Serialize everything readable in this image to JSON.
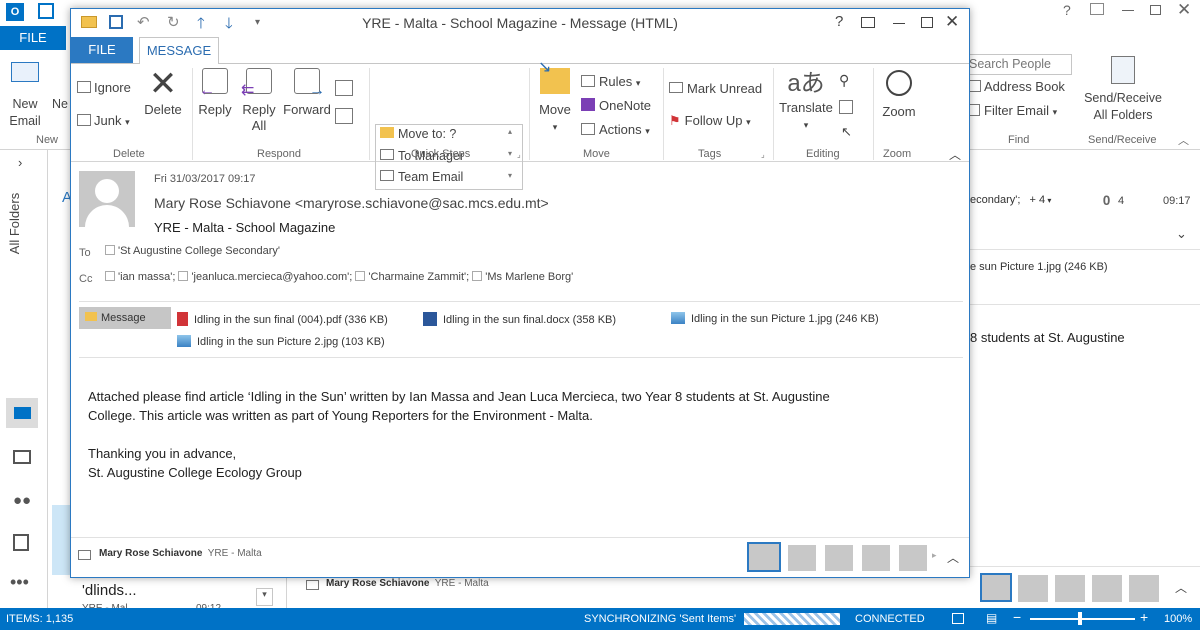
{
  "window": {
    "title": "YRE - Malta - School Magazine - Message (HTML)",
    "help": "?",
    "tab_file": "FILE",
    "tab_message": "MESSAGE"
  },
  "background": {
    "file_tab": "FILE",
    "new_email": "New Email",
    "new_items": "Ne Item",
    "new_group": "New",
    "search_people": "Search People",
    "address_book": "Address Book",
    "filter_email": "Filter Email",
    "find_group": "Find",
    "send_receive": "Send/Receive All Folders",
    "send_receive_group": "Send/Receive",
    "all_folders": "All Folders",
    "right_sender_tail": "econdary';",
    "right_plus": "+ 4",
    "right_attach_count": "4",
    "right_time": "09:17",
    "right_attachment": "e sun Picture 1.jpg (246 KB)",
    "right_body": "8 students at St. Augustine",
    "list_item_text": "'dlinds...",
    "list_item_sub": "YRE - Mal",
    "list_item_time": "09:12",
    "list_letter": "A",
    "bottom_sender": "Mary Rose Schiavone",
    "bottom_subject": "YRE - Malta"
  },
  "ribbon": {
    "delete_group": {
      "label": "Delete",
      "ignore": "Ignore",
      "junk": "Junk",
      "delete": "Delete"
    },
    "respond_group": {
      "label": "Respond",
      "reply": "Reply",
      "reply_all": "Reply All",
      "forward": "Forward"
    },
    "quick_steps": {
      "label": "Quick Steps",
      "items": [
        "Move to: ?",
        "To Manager",
        "Team Email"
      ]
    },
    "move_group": {
      "label": "Move",
      "move": "Move",
      "rules": "Rules",
      "onenote": "OneNote",
      "actions": "Actions"
    },
    "tags_group": {
      "label": "Tags",
      "mark_unread": "Mark Unread",
      "follow_up": "Follow Up"
    },
    "editing_group": {
      "label": "Editing",
      "translate": "Translate"
    },
    "zoom_group": {
      "label": "Zoom",
      "zoom": "Zoom"
    }
  },
  "message": {
    "date": "Fri 31/03/2017 09:17",
    "sender": "Mary Rose Schiavone <maryrose.schiavone@sac.mcs.edu.mt>",
    "subject": "YRE - Malta - School Magazine",
    "to_label": "To",
    "to": [
      "'St Augustine College Secondary'"
    ],
    "cc_label": "Cc",
    "cc": [
      "'ian massa';",
      "'jeanluca.mercieca@yahoo.com';",
      "'Charmaine Zammit';",
      "'Ms Marlene Borg'"
    ],
    "message_tab": "Message",
    "attachments": [
      {
        "name": "Idling in the sun final (004).pdf (336 KB)",
        "icon": "pdf-icon"
      },
      {
        "name": "Idling in the sun final.docx (358 KB)",
        "icon": "word-icon"
      },
      {
        "name": "Idling in the sun Picture 1.jpg (246 KB)",
        "icon": "image-icon"
      },
      {
        "name": "Idling in the sun Picture 2.jpg (103 KB)",
        "icon": "image-icon"
      }
    ],
    "body": [
      "Attached please find article ‘Idling in the Sun’ written by Ian Massa and Jean Luca Mercieca, two Year 8 students at St. Augustine",
      "College.  This article was written as part of Young Reporters for the Environment - Malta.",
      "",
      "Thanking you in advance,",
      "St. Augustine College Ecology Group"
    ]
  },
  "people_pane": {
    "sender": "Mary Rose Schiavone",
    "subject": "YRE - Malta"
  },
  "status": {
    "items": "ITEMS: 1,135",
    "sync": "SYNCHRONIZING  'Sent Items'",
    "connected": "CONNECTED",
    "zoom": "100%"
  },
  "colors": {
    "accent": "#0072c6",
    "window_border": "#2b79c2"
  }
}
